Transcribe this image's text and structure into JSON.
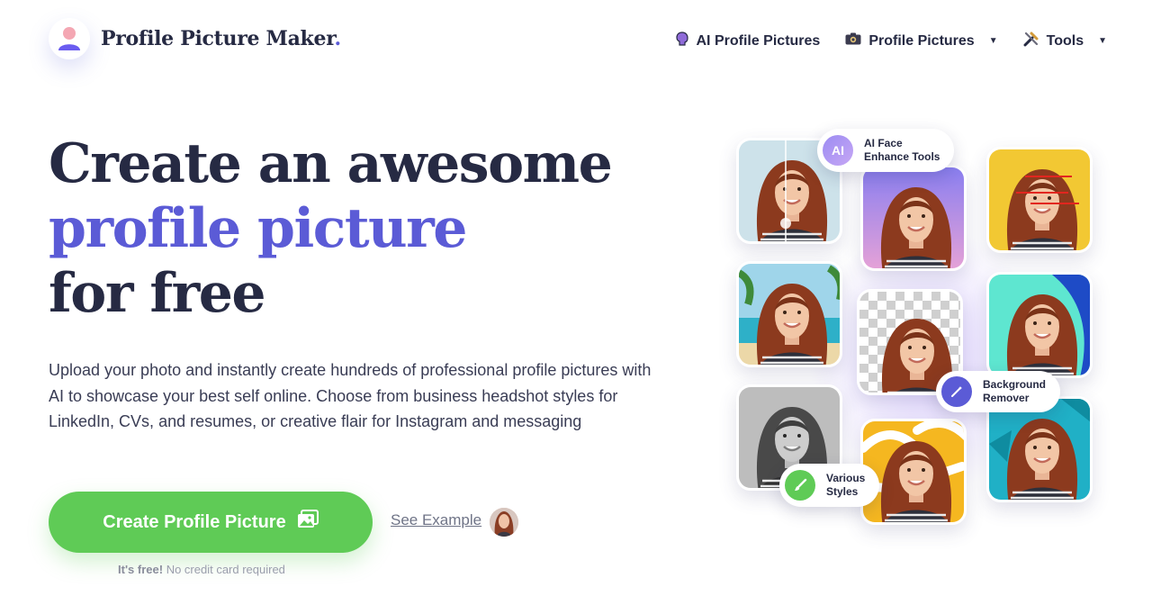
{
  "header": {
    "brand": "Profile Picture Maker",
    "brand_dot": ".",
    "nav": [
      {
        "label": "AI Profile Pictures",
        "icon": "brain-icon"
      },
      {
        "label": "Profile Pictures",
        "icon": "camera-icon",
        "has_dropdown": true
      },
      {
        "label": "Tools",
        "icon": "tools-icon",
        "has_dropdown": true
      }
    ]
  },
  "hero": {
    "headline_line1": "Create an awesome",
    "headline_line2": "profile picture",
    "headline_line3": "for free",
    "lead": "Upload your photo and instantly create hundreds of professional profile pictures with AI to showcase your best self online. Choose from business headshot styles for LinkedIn, CVs, and resumes, or creative flair for Instagram and messaging",
    "cta_label": "Create Profile Picture",
    "see_example": "See Example",
    "free_bold": "It's free!",
    "free_rest": "No credit card required"
  },
  "features": {
    "ai_icon": "AI",
    "ai_line1": "AI Face",
    "ai_line2": "Enhance Tools",
    "bg_line1": "Background",
    "bg_line2": "Remover",
    "styles_line1": "Various",
    "styles_line2": "Styles"
  },
  "colors": {
    "accent": "#5b5bd6",
    "cta": "#5fcb56",
    "text": "#262a43"
  }
}
